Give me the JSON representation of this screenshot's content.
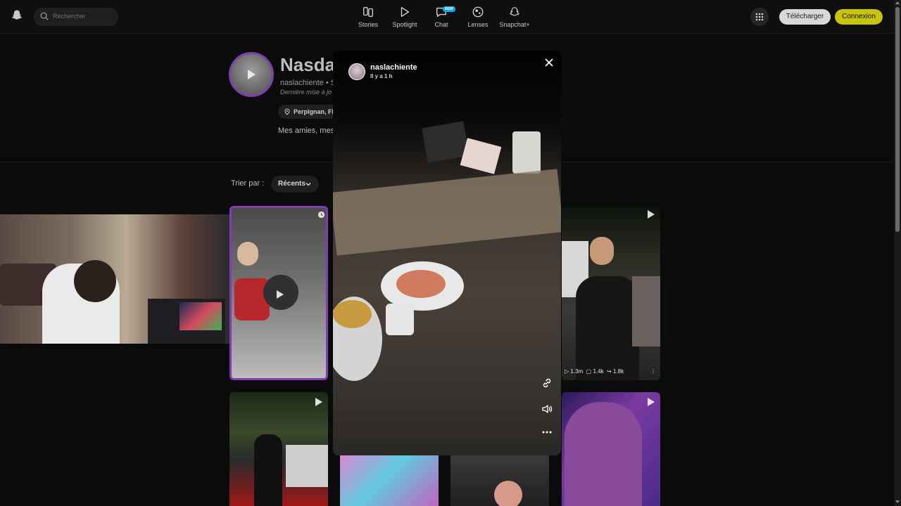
{
  "header": {
    "logo_icon": "ghost-icon",
    "search_placeholder": "Rechercher",
    "nav": [
      {
        "label": "Stories",
        "icon": "stories-icon"
      },
      {
        "label": "Spotlight",
        "icon": "play-icon"
      },
      {
        "label": "Chat",
        "icon": "chat-icon",
        "badge": "NEW"
      },
      {
        "label": "Lenses",
        "icon": "lens-icon"
      },
      {
        "label": "Snapchat+",
        "icon": "snapchat-plus-icon"
      }
    ],
    "apps_icon": "grid-icon",
    "download_label": "Télécharger",
    "login_label": "Connexion"
  },
  "profile": {
    "name": "Nasdas",
    "username": "naslachiente",
    "username_suffix": "• S",
    "updated": "Dernière mise à jo",
    "location": "Perpignan, Fl",
    "bio": "Mes amies, mes"
  },
  "sort": {
    "label": "Trier par :",
    "value": "Récents"
  },
  "grid": {
    "tile_stats": {
      "views": "1.3m",
      "comments": "1.4k",
      "shares": "1.8k"
    }
  },
  "viewer": {
    "username": "naslachiente",
    "time": "Il y a 1 h"
  },
  "colors": {
    "accent_yellow": "#c8c40a",
    "profile_ring": "#7d3fb0",
    "background": "#0b0b0b"
  }
}
